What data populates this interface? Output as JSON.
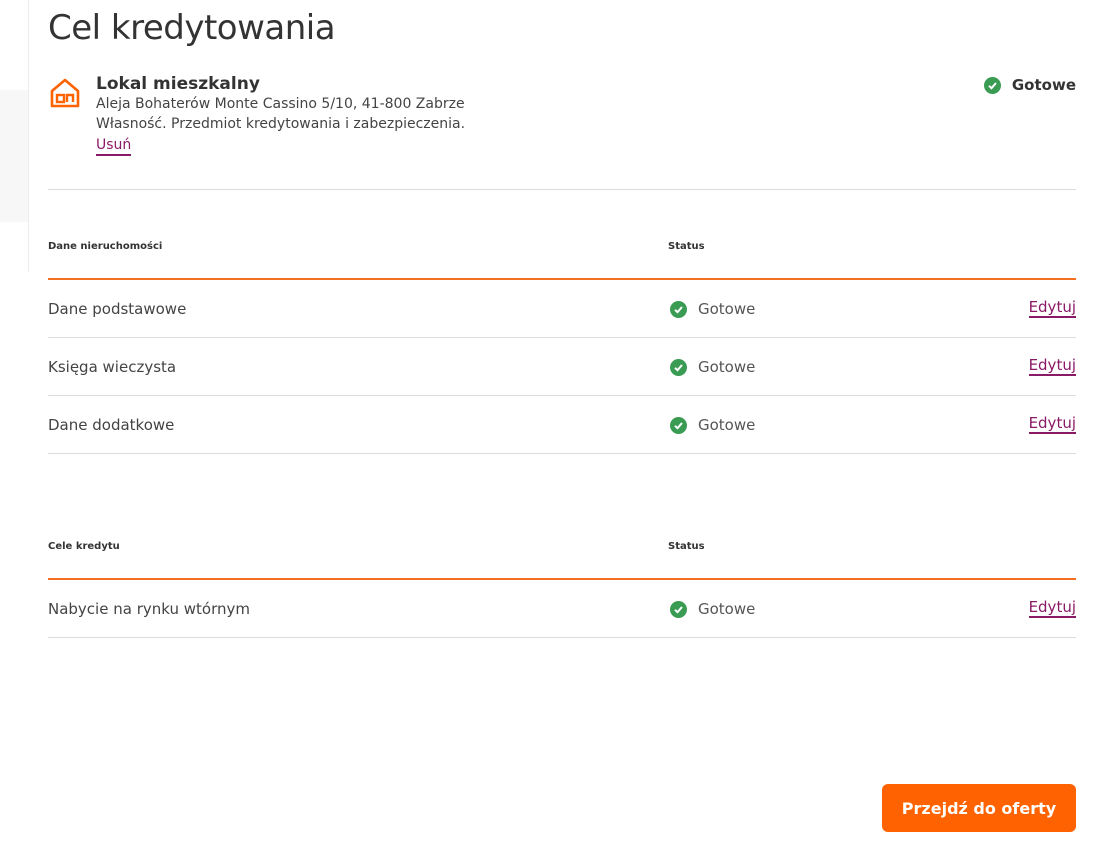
{
  "page": {
    "title": "Cel kredytowania"
  },
  "property": {
    "icon": "house-icon",
    "name": "Lokal mieszkalny",
    "address": "Aleja Bohaterów Monte Cassino 5/10, 41-800 Zabrze",
    "description": "Własność. Przedmiot kredytowania i zabezpieczenia.",
    "remove_label": "Usuń",
    "status_label": "Gotowe",
    "status_icon": "check-circle-icon"
  },
  "property_table": {
    "headers": [
      "Dane nieruchomości",
      "Status"
    ],
    "rows": [
      {
        "name": "Dane podstawowe",
        "status": "Gotowe",
        "action": "Edytuj"
      },
      {
        "name": "Księga wieczysta",
        "status": "Gotowe",
        "action": "Edytuj"
      },
      {
        "name": "Dane dodatkowe",
        "status": "Gotowe",
        "action": "Edytuj"
      }
    ]
  },
  "goals_table": {
    "headers": [
      "Cele kredytu",
      "Status"
    ],
    "rows": [
      {
        "name": "Nabycie na rynku wtórnym",
        "status": "Gotowe",
        "action": "Edytuj"
      }
    ]
  },
  "footer": {
    "primary_button": "Przejdź do oferty"
  },
  "colors": {
    "accent": "#ff6200",
    "link": "#8b1a66",
    "success": "#3a9b52",
    "divider": "#dcdcdc"
  }
}
